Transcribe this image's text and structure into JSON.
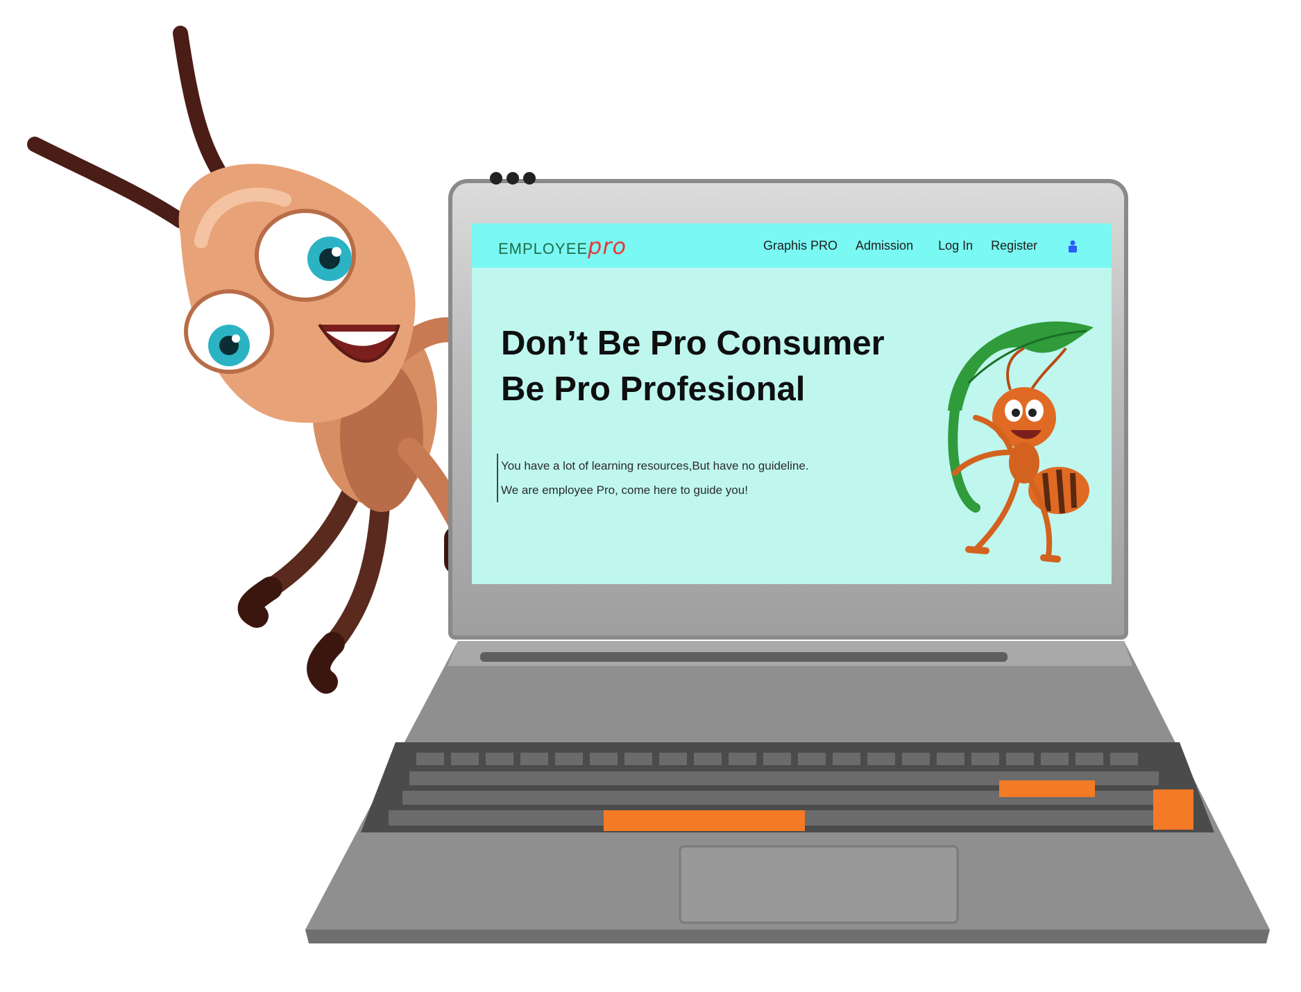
{
  "window": {
    "brand": {
      "prefix": "EMPLOYEE",
      "suffix": "pro"
    }
  },
  "navbar": {
    "links": [
      {
        "label": "Graphis PRO"
      },
      {
        "label": "Admission"
      },
      {
        "label": "Log In"
      },
      {
        "label": "Register"
      }
    ],
    "user_icon": "user-icon"
  },
  "hero": {
    "title_line1": "Don’t Be Pro Consumer",
    "title_line2": "Be Pro Profesional",
    "text_line1": "You have a lot of learning resources,But have no guideline.",
    "text_line2": "We are employee Pro, come here to guide you!"
  },
  "colors": {
    "navbar_bg": "#7af8f3",
    "screen_bg": "#bff7ef",
    "logo_green": "#1f6b4a",
    "logo_red": "#e23b3b",
    "accent_orange": "#f47a26",
    "user_icon_blue": "#2c5ef5"
  },
  "illustrations": {
    "left": "cartoon-ant-peeking-icon",
    "right": "ant-holding-leaf-icon"
  }
}
